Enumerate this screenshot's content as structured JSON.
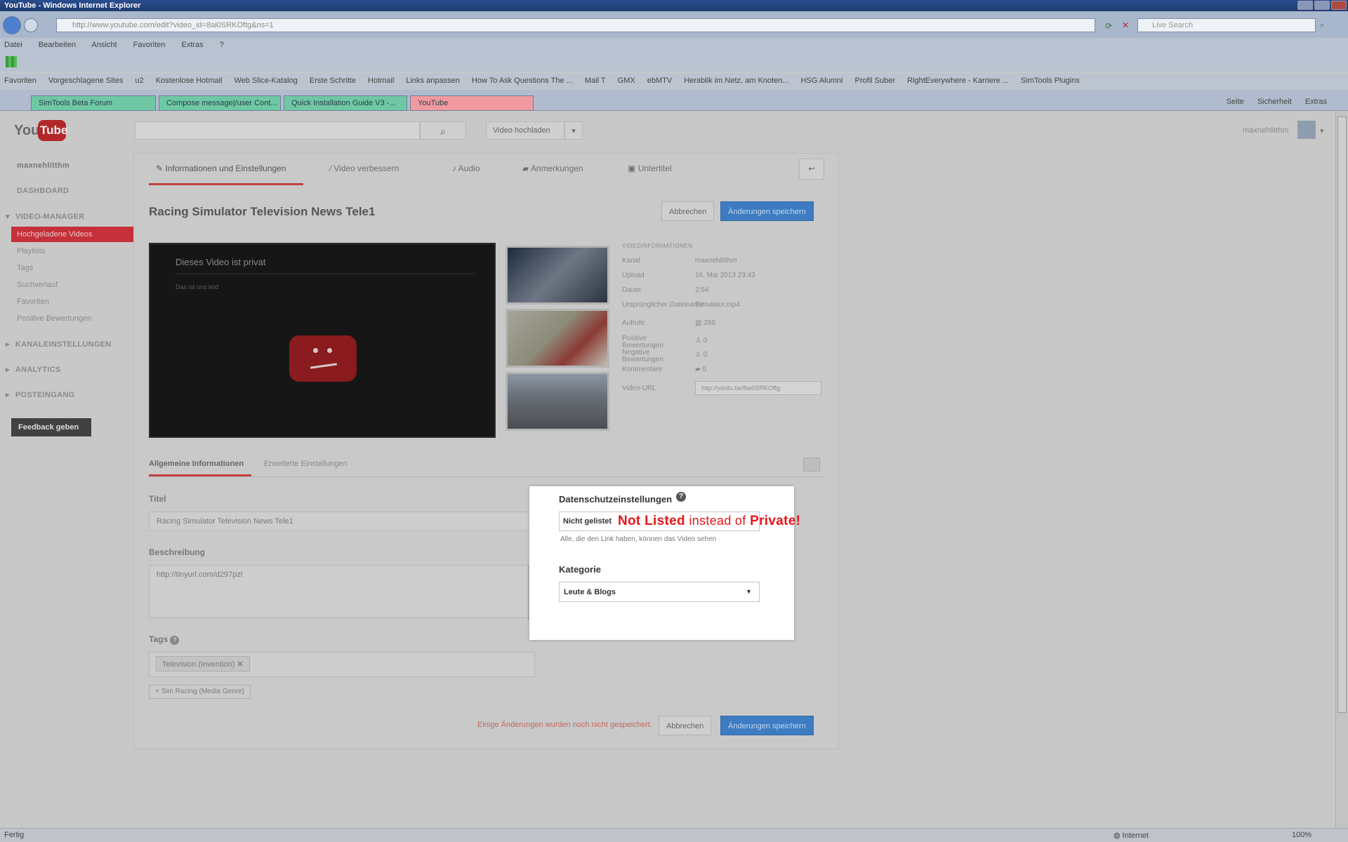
{
  "browser": {
    "title": "YouTube - Windows Internet Explorer",
    "address": "http://www.youtube.com/edit?video_id=8ai0SRKOftg&ns=1",
    "live_search_placeholder": "Live Search",
    "menu": [
      "Datei",
      "Bearbeiten",
      "Ansicht",
      "Favoriten",
      "Extras",
      "?"
    ],
    "favorites_label": "Favoriten",
    "favorites": [
      "Vorgeschlagene Sites",
      "u2",
      "Kostenlose Hotmail",
      "Web Slice-Katalog",
      "Erste Schritte",
      "Hotmail",
      "Links anpassen",
      "How To Ask Questions The ...",
      "Mail T",
      "GMX",
      "ebMTV",
      "Herablik im Netz, am Knoten...",
      "HSG Alumni",
      "Profil Suber",
      "RightEverywhere - Karriere ...",
      "SimTools Plugins"
    ],
    "tabs": [
      "SimTools Beta Forum",
      "Compose message|/user Cont...",
      "Quick Installation Guide V3 -...",
      "YouTube"
    ],
    "tools": [
      "Seite",
      "Sicherheit",
      "Extras"
    ],
    "status_left": "Fertig",
    "status_zone": "Internet",
    "zoom": "100%"
  },
  "youtube": {
    "logo_you": "You",
    "logo_tube": "Tube",
    "upload_label": "Video hochladen",
    "username": "maxnehlitthm"
  },
  "sidebar": {
    "user": "maxnehlitthm",
    "dashboard": "DASHBOARD",
    "video_manager": "VIDEO-MANAGER",
    "active": "Hochgeladene Videos",
    "items": [
      "Playlists",
      "Tags",
      "Suchverlauf",
      "Favoriten",
      "Positive Bewertungen"
    ],
    "sections": [
      "KANALEINSTELLUNGEN",
      "ANALYTICS",
      "POSTEINGANG"
    ],
    "feedback": "Feedback geben"
  },
  "editor": {
    "tabs": [
      "Informationen und Einstellungen",
      "Video verbessern",
      "Audio",
      "Anmerkungen",
      "Untertitel"
    ],
    "back": "↩",
    "video_title": "Racing Simulator Television News Tele1",
    "cancel": "Abbrechen",
    "save": "Änderungen speichern",
    "player_message": "Dieses Video ist privat",
    "player_sub": "Das ist uns leid",
    "video_info": {
      "heading": "VIDEOINFORMATIONEN",
      "rows": [
        {
          "label": "Kanal",
          "value": "maxnehlitthm"
        },
        {
          "label": "Upload",
          "value": "16. Mai 2013 23:43"
        },
        {
          "label": "Dauer",
          "value": "2:54"
        },
        {
          "label": "Ursprünglicher Dateiname",
          "value": "Simulator.mp4"
        },
        {
          "label": "Aufrufe",
          "value": "288"
        },
        {
          "label": "Positive Bewertungen",
          "value": "0"
        },
        {
          "label": "Negative Bewertungen",
          "value": "0"
        },
        {
          "label": "Kommentare",
          "value": "0"
        }
      ],
      "url_label": "Video-URL",
      "url": "http://youtu.be/8ai0SRKOftg"
    },
    "subtabs": [
      "Allgemeine Informationen",
      "Erweiterte Einstellungen"
    ],
    "title_label": "Titel",
    "title_value": "Racing Simulator Television News Tele1",
    "desc_label": "Beschreibung",
    "desc_value": "http://tinyurl.com/d297pzl",
    "tags_label": "Tags",
    "tag_chip": "Television (Invention)",
    "tag_suggest": "+ Sim Racing (Media Genre)",
    "unsaved": "Einige Änderungen wurden noch nicht gespeichert."
  },
  "modal": {
    "privacy_title": "Datenschutzeinstellungen",
    "help": "?",
    "privacy_value": "Nicht gelistet",
    "annotation_a": "Not Listed",
    "annotation_b": "instead of",
    "annotation_c": "Private!",
    "privacy_hint": "Alle, die den Link haben, können das Video sehen",
    "category_label": "Kategorie",
    "category_value": "Leute & Blogs"
  }
}
